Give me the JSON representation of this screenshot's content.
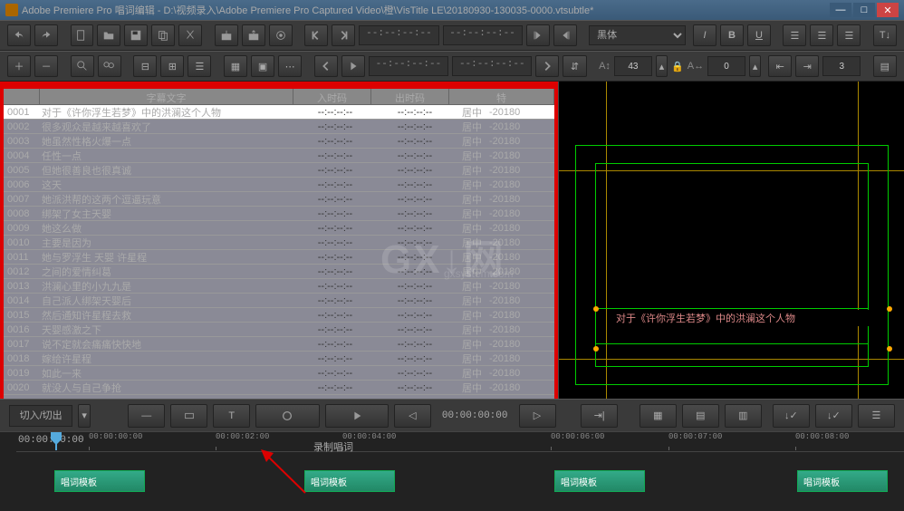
{
  "title": "Adobe Premiere Pro 唱词编辑  - D:\\视频录入\\Adobe Premiere Pro Captured Video\\橙\\VisTitle LE\\20180930-130035-0000.vtsubtle*",
  "headers": {
    "num": "#",
    "subject": "字幕文字",
    "in": "入时码",
    "out": "出时码",
    "extra": "特"
  },
  "tcplaceholder": "--:--:--:--",
  "align": "居中",
  "datecol": "20180",
  "rows": [
    {
      "n": "0001",
      "t": "对于《许你浮生若梦》中的洪澜这个人物"
    },
    {
      "n": "0002",
      "t": "很多观众是越来越喜欢了"
    },
    {
      "n": "0003",
      "t": "她虽然性格火爆一点"
    },
    {
      "n": "0004",
      "t": "任性一点"
    },
    {
      "n": "0005",
      "t": "但她很善良也很真诚"
    },
    {
      "n": "0006",
      "t": "这天"
    },
    {
      "n": "0007",
      "t": "她派洪帮的这两个逗逼玩意"
    },
    {
      "n": "0008",
      "t": "绑架了女主天婴"
    },
    {
      "n": "0009",
      "t": "她这么做"
    },
    {
      "n": "0010",
      "t": "主要是因为"
    },
    {
      "n": "0011",
      "t": "她与罗浮生 天婴 许星程"
    },
    {
      "n": "0012",
      "t": "之间的爱情纠葛"
    },
    {
      "n": "0013",
      "t": "洪澜心里的小九九是"
    },
    {
      "n": "0014",
      "t": "自己派人绑架天婴后"
    },
    {
      "n": "0015",
      "t": "然后通知许星程去救"
    },
    {
      "n": "0016",
      "t": "天婴感激之下"
    },
    {
      "n": "0017",
      "t": "说不定就会痛痛快快地"
    },
    {
      "n": "0018",
      "t": "嫁给许星程"
    },
    {
      "n": "0019",
      "t": "如此一来"
    },
    {
      "n": "0020",
      "t": "就没人与自己争抢"
    }
  ],
  "previewText": "对于《许你浮生若梦》中的洪澜这个人物",
  "editmode": "切入/切出",
  "font": "黑体",
  "sizes": {
    "a": "43",
    "b": "0",
    "c": "3"
  },
  "transportTc": "00:00:00:00",
  "timelineTc": "00:00:00:00",
  "ticks": [
    "00:00:00:00",
    "00:00:02:00",
    "00:00:04:00",
    "00:00:06:00",
    "00:00:07:00",
    "00:00:08:00"
  ],
  "trackLabel": "录制唱词",
  "clip": "唱词模板"
}
